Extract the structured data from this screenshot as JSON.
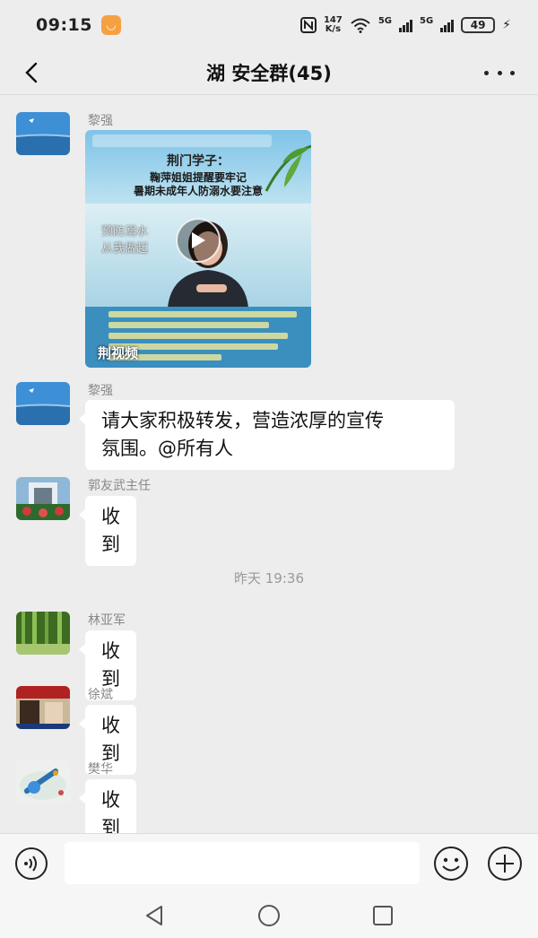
{
  "status_bar": {
    "time": "09:15",
    "app_badge": "◡",
    "net_speed_value": "147",
    "net_speed_unit": "K/s",
    "net_type_1": "5G",
    "net_type_2": "5G",
    "battery": "49"
  },
  "header": {
    "title": "湖 安全群(45)"
  },
  "messages": [
    {
      "sender": "黎强",
      "type": "video"
    },
    {
      "sender": "黎强",
      "text_line1": "请大家积极转发，营造浓厚的宣传",
      "text_line2": "氛围。@所有人"
    },
    {
      "sender": "郭友武主任",
      "text": "收到"
    },
    {
      "sender": "林亚军",
      "text": "收到"
    },
    {
      "sender": "徐斌",
      "text": "收到"
    },
    {
      "sender": "樊华",
      "text": "收到"
    }
  ],
  "time_separator": "昨天 19:36",
  "video": {
    "title_line1": "荆门学子：",
    "title_line2": "鞠萍姐姐提醒要牢记",
    "title_line3": "暑期未成年人防溺水要注意",
    "slogan_line1": "预防溺水",
    "slogan_line2": "从我做起",
    "brand": "荆视频"
  },
  "input": {
    "placeholder": ""
  },
  "colors": {
    "background": "#ededed",
    "bubble": "#ffffff",
    "sender_text": "#888888"
  },
  "icons": [
    "back-arrow-icon",
    "more-dots-icon",
    "voice-icon",
    "emoji-icon",
    "plus-icon",
    "play-icon",
    "nav-back-icon",
    "nav-home-icon",
    "nav-recents-icon"
  ]
}
